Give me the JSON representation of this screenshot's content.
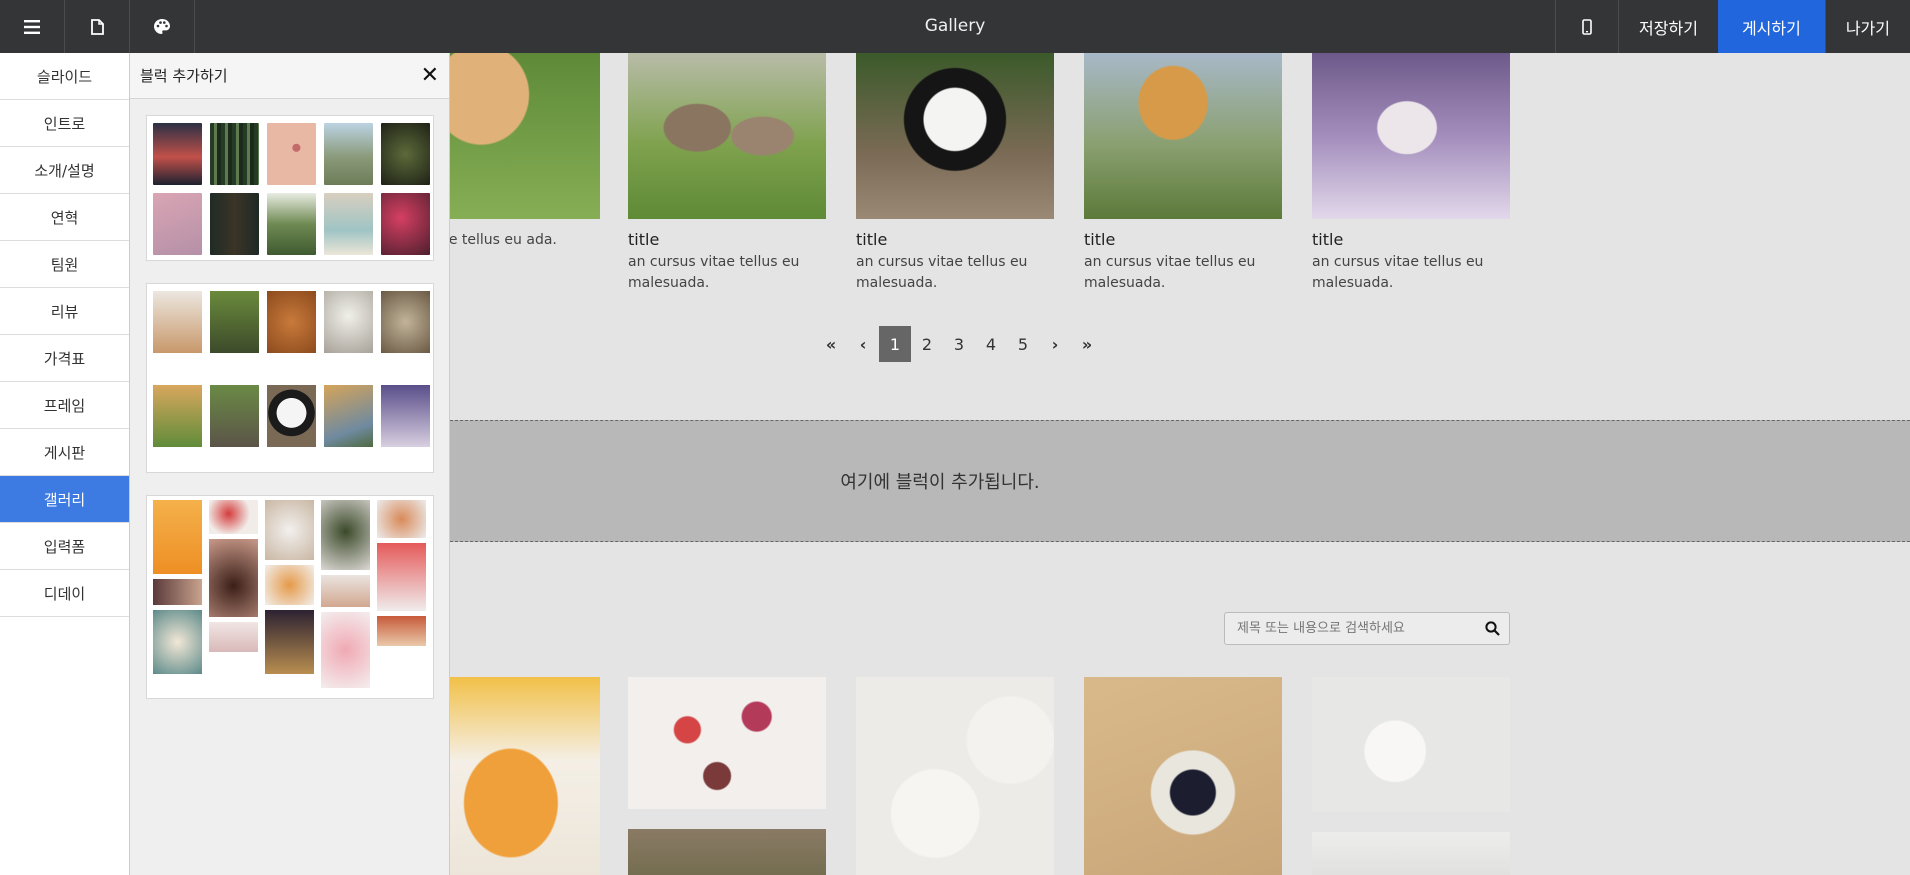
{
  "topbar": {
    "title": "Gallery",
    "save_label": "저장하기",
    "publish_label": "게시하기",
    "exit_label": "나가기",
    "icons": [
      "menu-icon",
      "file-icon",
      "palette-icon",
      "mobile-icon"
    ],
    "colors": {
      "bar": "#333537",
      "primary": "#2266dd"
    }
  },
  "sidebar": {
    "items": [
      {
        "label": "슬라이드"
      },
      {
        "label": "인트로"
      },
      {
        "label": "소개/설명"
      },
      {
        "label": "연혁"
      },
      {
        "label": "팀원"
      },
      {
        "label": "리뷰"
      },
      {
        "label": "가격표"
      },
      {
        "label": "프레임"
      },
      {
        "label": "게시판"
      },
      {
        "label": "갤러리"
      },
      {
        "label": "입력폼"
      },
      {
        "label": "디데이"
      }
    ],
    "active": "갤러리",
    "active_color": "#3d7be3"
  },
  "panel": {
    "title": "블럭 추가하기",
    "close_icon": "close-icon"
  },
  "gallery": {
    "cards": [
      {
        "title": "",
        "desc": "us vitae tellus eu ada."
      },
      {
        "title": "title",
        "desc": "an cursus vitae tellus eu malesuada."
      },
      {
        "title": "title",
        "desc": "an cursus vitae tellus eu malesuada."
      },
      {
        "title": "title",
        "desc": "an cursus vitae tellus eu malesuada."
      },
      {
        "title": "title",
        "desc": "an cursus vitae tellus eu malesuada."
      }
    ],
    "pagination": {
      "first": "«",
      "prev": "‹",
      "next": "›",
      "last": "»",
      "pages": [
        "1",
        "2",
        "3",
        "4",
        "5"
      ],
      "current": "1"
    }
  },
  "dropzone": {
    "text": "여기에 블럭이 추가됩니다."
  },
  "food_gallery": {
    "search_placeholder": "제목 또는 내용으로 검색하세요",
    "search_icon": "search-icon"
  }
}
